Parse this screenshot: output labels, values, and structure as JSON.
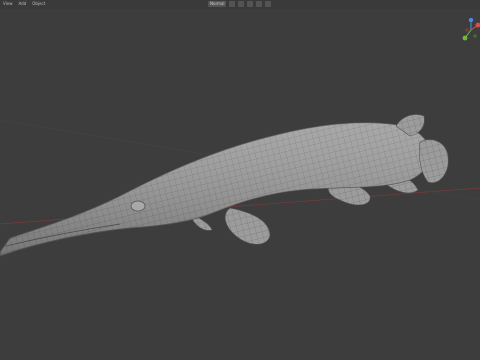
{
  "header": {
    "menu": [
      "View",
      "Add",
      "Object"
    ],
    "shading_label": "Normal",
    "icons": [
      "select-box-icon",
      "cursor-icon",
      "move-icon",
      "pivot-icon",
      "snap-icon",
      "proportional-icon"
    ]
  },
  "gizmo": {
    "axes": [
      "X",
      "Y",
      "Z"
    ],
    "colors": {
      "x": "#e04a4a",
      "y": "#74b83a",
      "z": "#4a8ae0"
    }
  },
  "scene": {
    "object": "gar-fish-mesh",
    "wire_color": "#6f6f6f",
    "body_color": "#9a9a9a"
  },
  "colors": {
    "background": "#3d3d3d",
    "x_axis_line": "#8a3a3a",
    "y_axis_line": "#5a7a3a"
  }
}
